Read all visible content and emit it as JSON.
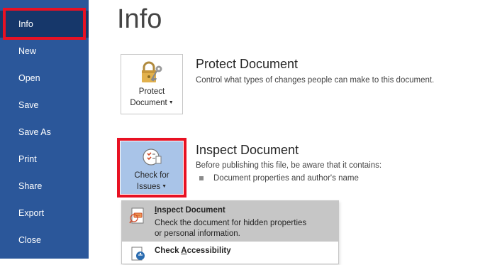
{
  "sidebar": {
    "items": [
      {
        "label": "Info",
        "active": true
      },
      {
        "label": "New"
      },
      {
        "label": "Open"
      },
      {
        "label": "Save"
      },
      {
        "label": "Save As"
      },
      {
        "label": "Print"
      },
      {
        "label": "Share"
      },
      {
        "label": "Export"
      },
      {
        "label": "Close"
      }
    ]
  },
  "main": {
    "title": "Info",
    "protect": {
      "button_line1": "Protect",
      "button_line2": "Document",
      "title": "Protect Document",
      "description": "Control what types of changes people can make to this document."
    },
    "inspect": {
      "button_line1": "Check for",
      "button_line2": "Issues",
      "title": "Inspect Document",
      "description": "Before publishing this file, be aware that it contains:",
      "bullets": [
        "Document properties and author's name"
      ]
    }
  },
  "dropdown": {
    "items": [
      {
        "title_prefix": "I",
        "title_rest": "nspect Document",
        "desc_line1": "Check the document for hidden properties",
        "desc_line2": "or personal information."
      },
      {
        "title_prefix": "Check ",
        "title_accel": "A",
        "title_rest": "ccessibility"
      }
    ]
  },
  "colors": {
    "sidebar": "#2b579a",
    "sidebar_active": "#16376a",
    "highlight_box": "#e81123",
    "button_selected": "#a9c4e8",
    "menu_hover": "#c6c6c6"
  }
}
